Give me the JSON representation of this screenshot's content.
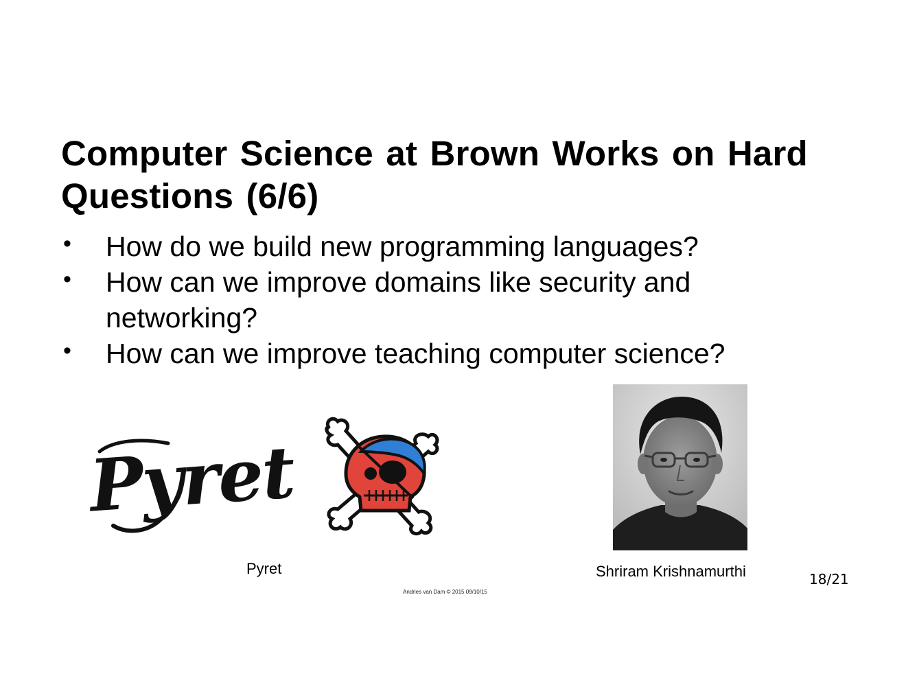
{
  "slide": {
    "title_lines": [
      "Computer Science at Brown Works on Hard",
      "Questions (6/6)"
    ],
    "bullet_symbol": "•",
    "bullets": [
      {
        "lines": [
          "How do we build new programming languages?"
        ]
      },
      {
        "lines": [
          "How can we improve domains like security and",
          "networking?"
        ]
      },
      {
        "lines": [
          "How can we improve teaching computer science?"
        ]
      }
    ],
    "pyret_logo": {
      "wordmark": "Pyret",
      "icon": "pirate-skull-crossbones-icon",
      "colors": {
        "skull_red": "#e0443a",
        "bandana_blue": "#2f7fd6",
        "outline": "#111111"
      }
    },
    "pyret_caption": "Pyret",
    "photo": {
      "icon": "portrait-photo"
    },
    "photo_caption": "Shriram Krishnamurthi",
    "page_number": "18/21",
    "footer": "Andries van Dam © 2015 09/10/15"
  }
}
